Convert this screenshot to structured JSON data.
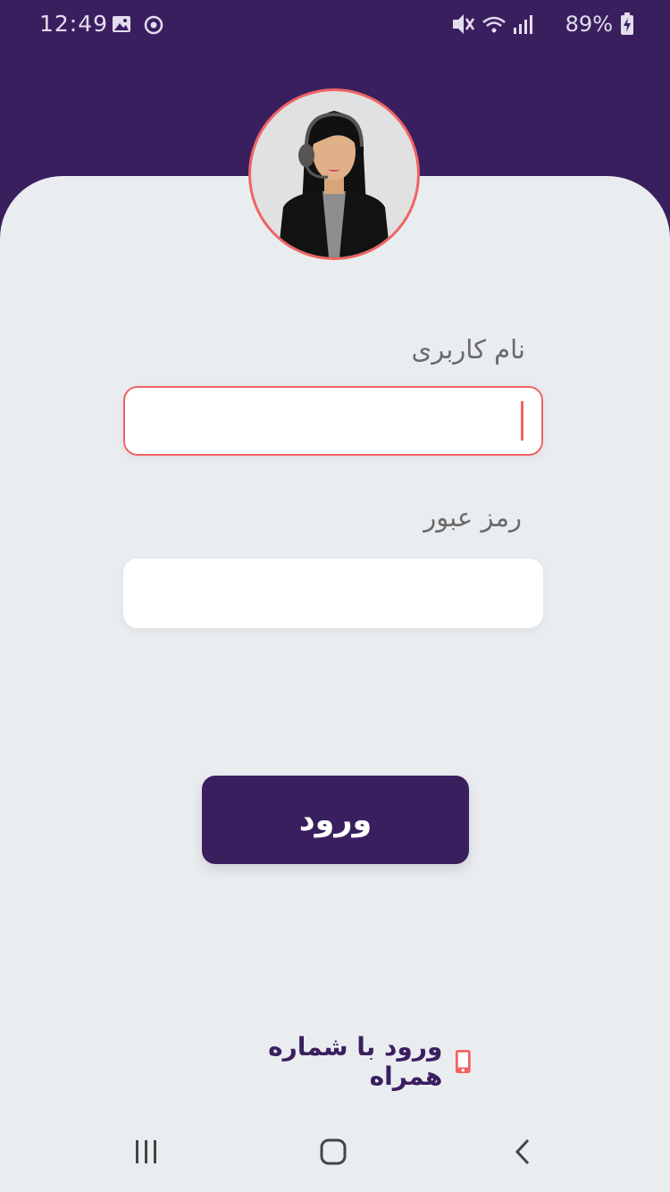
{
  "status_bar": {
    "time": "12:49",
    "battery": "89%",
    "icons": [
      "gallery-icon",
      "sync-icon",
      "mute-icon",
      "wifi-icon",
      "signal-icon",
      "battery-charging-icon"
    ]
  },
  "avatar": {
    "icon": "support-agent-avatar"
  },
  "form": {
    "username_label": "نام کاربری",
    "username_value": "",
    "password_label": "رمز عبور",
    "password_value": ""
  },
  "login_button": {
    "label": "ورود"
  },
  "phone_login": {
    "label": "ورود با شماره همراه",
    "icon": "mobile-phone-icon"
  },
  "nav_bar": {
    "items": [
      "recent-apps-icon",
      "home-icon",
      "back-icon"
    ]
  },
  "colors": {
    "primary": "#3a1f5f",
    "accent": "#ef6464",
    "background": "#eaedf0",
    "field": "#ffffff"
  }
}
